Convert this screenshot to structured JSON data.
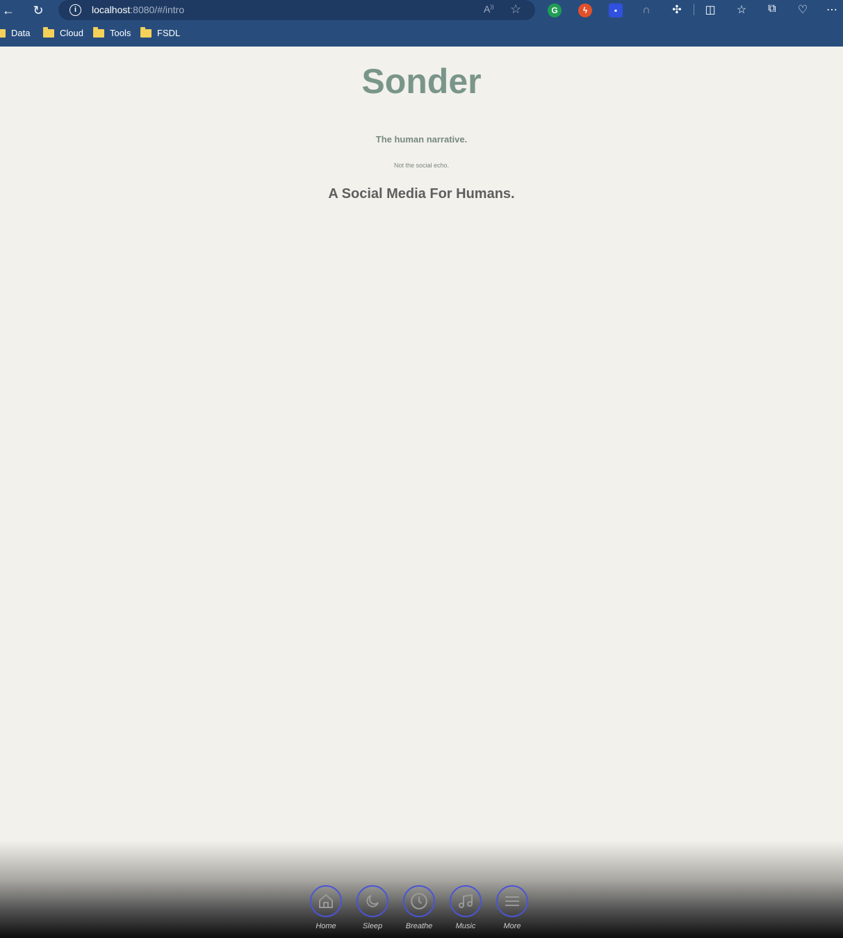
{
  "browser": {
    "url_host": "localhost",
    "url_rest": ":8080/#/intro",
    "bookmarks": [
      {
        "label": "Data"
      },
      {
        "label": "Cloud"
      },
      {
        "label": "Tools"
      },
      {
        "label": "FSDL"
      }
    ]
  },
  "page": {
    "title": "Sonder",
    "tagline": "The human narrative.",
    "subtagline": "Not the social echo.",
    "heading": "A Social Media For Humans."
  },
  "nav": {
    "accent": "#4b55d6",
    "items": [
      {
        "label": "Home",
        "icon": "home-icon"
      },
      {
        "label": "Sleep",
        "icon": "moon-icon"
      },
      {
        "label": "Breathe",
        "icon": "clock-icon"
      },
      {
        "label": "Music",
        "icon": "music-icon"
      },
      {
        "label": "More",
        "icon": "menu-icon"
      }
    ]
  }
}
